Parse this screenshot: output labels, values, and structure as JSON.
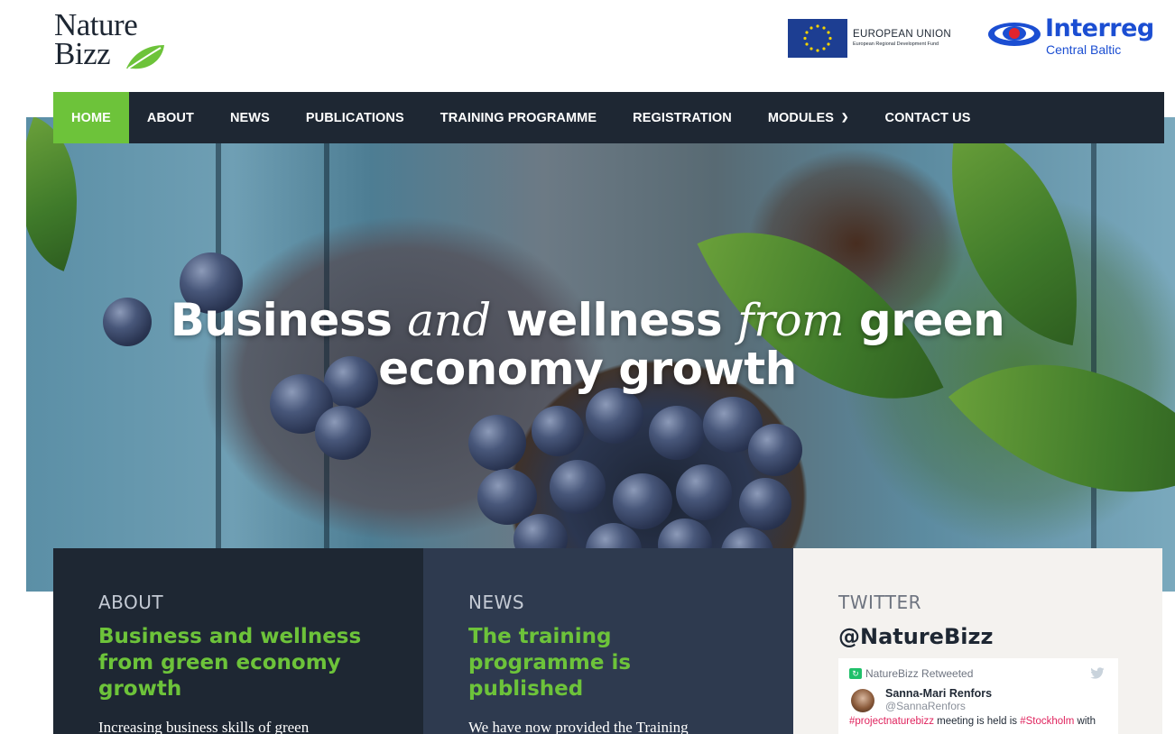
{
  "brand": {
    "logo_line1": "Nature",
    "logo_line2": "Bizz"
  },
  "partners": {
    "eu_title": "EUROPEAN UNION",
    "eu_subtitle": "European Regional Development Fund",
    "interreg_name": "Interreg",
    "interreg_sub": "Central Baltic"
  },
  "nav": {
    "items": [
      {
        "label": "HOME"
      },
      {
        "label": "ABOUT"
      },
      {
        "label": "NEWS"
      },
      {
        "label": "PUBLICATIONS"
      },
      {
        "label": "TRAINING PROGRAMME"
      },
      {
        "label": "REGISTRATION"
      },
      {
        "label": "MODULES"
      },
      {
        "label": "CONTACT US"
      }
    ],
    "active": "HOME",
    "active_color": "#6dc33a",
    "bar_color": "#1e2733"
  },
  "hero": {
    "w1": "Business",
    "w2": "and",
    "w3": "wellness",
    "w4": "from",
    "w5": "green",
    "line2": "economy growth"
  },
  "about": {
    "kicker": "ABOUT",
    "heading": "Business and wellness from green economy growth",
    "body": "Increasing  business skills of green"
  },
  "news": {
    "kicker": "NEWS",
    "heading": "The training programme is published",
    "body": "We have now provided the Training"
  },
  "twitter": {
    "kicker": "TWITTER",
    "handle_heading": "@NatureBizz",
    "retweeted": "NatureBizz Retweeted",
    "author_name": "Sanna-Mari Renfors",
    "author_handle": "@SannaRenfors",
    "tweet_hash1": "#projectnaturebizz",
    "tweet_mid": " meeting is held is ",
    "tweet_hash2": "#Stockholm",
    "tweet_end": " with"
  }
}
